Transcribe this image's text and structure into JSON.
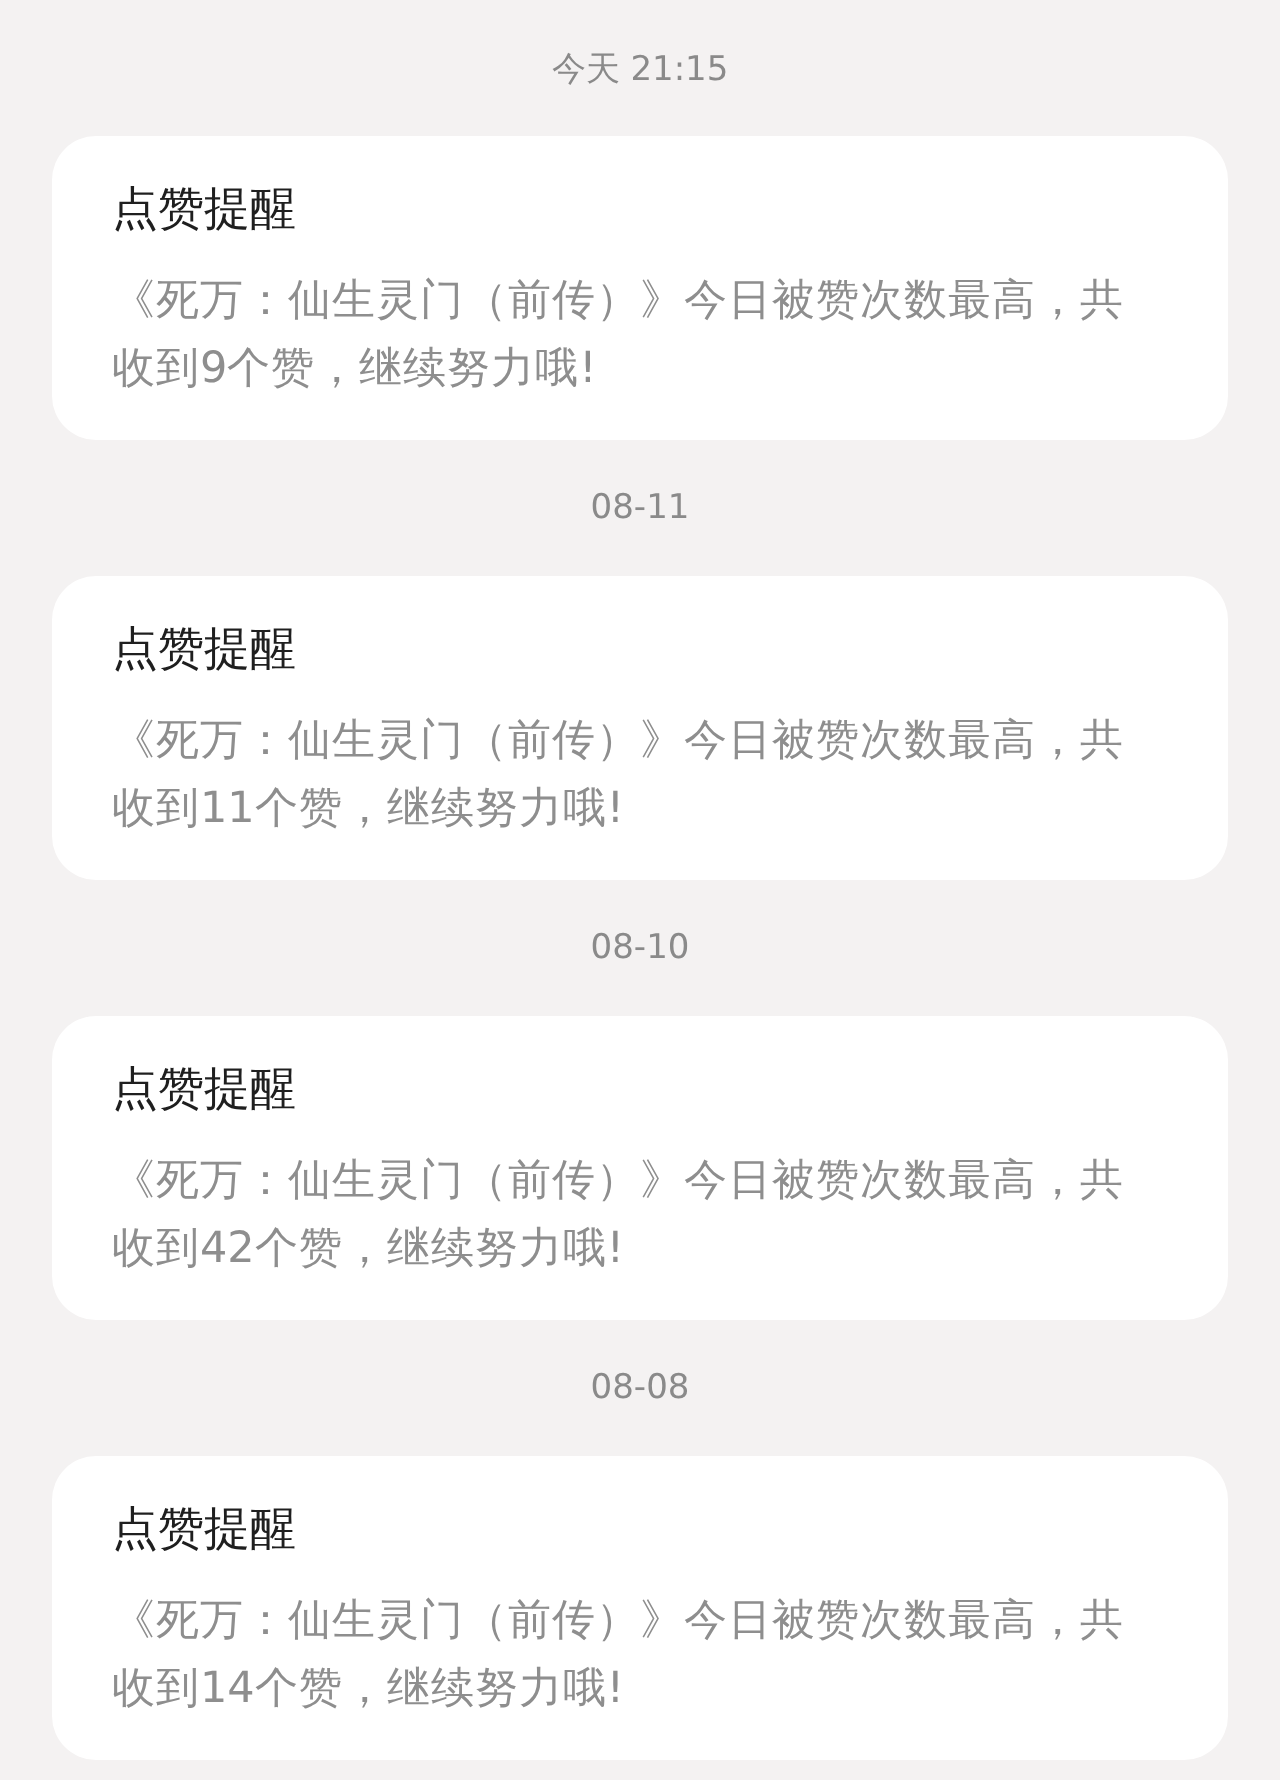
{
  "notifications": [
    {
      "time": "今天 21:15",
      "title": "点赞提醒",
      "body": "《死万：仙生灵门（前传）》今日被赞次数最高，共收到9个赞，继续努力哦!"
    },
    {
      "time": "08-11",
      "title": "点赞提醒",
      "body": "《死万：仙生灵门（前传）》今日被赞次数最高，共收到11个赞，继续努力哦!"
    },
    {
      "time": "08-10",
      "title": "点赞提醒",
      "body": "《死万：仙生灵门（前传）》今日被赞次数最高，共收到42个赞，继续努力哦!"
    },
    {
      "time": "08-08",
      "title": "点赞提醒",
      "body": "《死万：仙生灵门（前传）》今日被赞次数最高，共收到14个赞，继续努力哦!"
    }
  ]
}
